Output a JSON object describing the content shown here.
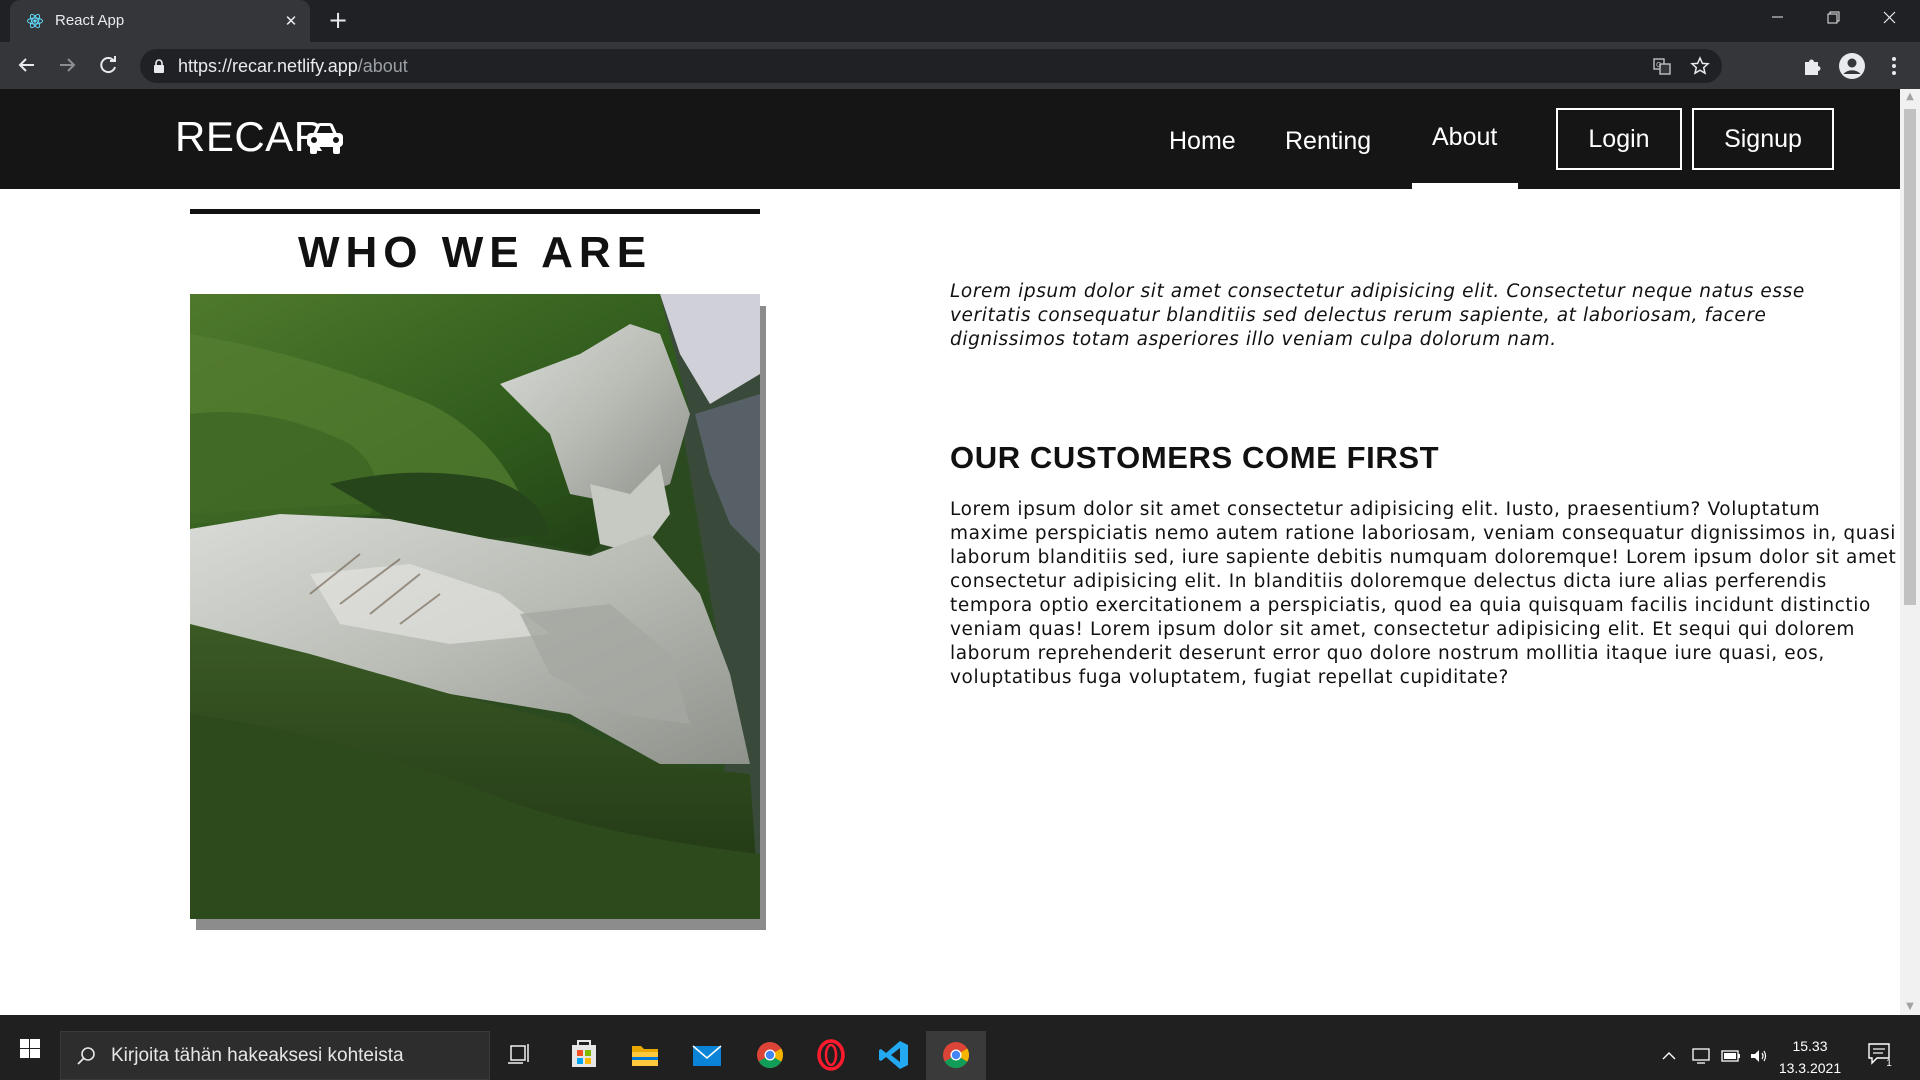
{
  "browser": {
    "tab_title": "React App",
    "tab_close": "✕",
    "new_tab": "+",
    "url_host": "https://recar.netlify.app",
    "url_path": "/about"
  },
  "site": {
    "brand": "RECAR",
    "nav": {
      "home": "Home",
      "renting": "Renting",
      "about": "About",
      "active": "About"
    },
    "login_label": "Login",
    "signup_label": "Signup"
  },
  "page": {
    "who_title": "WHO WE ARE",
    "intro": "Lorem ipsum dolor sit amet consectetur adipisicing elit. Consectetur neque natus esse veritatis consequatur blanditiis sed delectus rerum sapiente, at laboriosam, facere dignissimos totam asperiores illo veniam culpa dolorum nam.",
    "section_title": "OUR CUSTOMERS COME FIRST",
    "section_body": "Lorem ipsum dolor sit amet consectetur adipisicing elit. Iusto, praesentium? Voluptatum maxime perspiciatis nemo autem ratione laboriosam, veniam consequatur dignissimos in, quasi laborum blanditiis sed, iure sapiente debitis numquam doloremque! Lorem ipsum dolor sit amet consectetur adipisicing elit. In blanditiis doloremque delectus dicta iure alias perferendis tempora optio exercitationem a perspiciatis, quod ea quia quisquam facilis incidunt distinctio veniam quas! Lorem ipsum dolor sit amet, consectetur adipisicing elit. Et sequi qui dolorem laborum reprehenderit deserunt error quo dolore nostrum mollitia itaque iure quasi, eos, voluptatibus fuga voluptatem, fugiat repellat cupiditate?"
  },
  "taskbar": {
    "search_placeholder": "Kirjoita tähän hakeaksesi kohteista",
    "time": "15.33",
    "date": "13.3.2021",
    "notification_count": "1",
    "apps": [
      "task-view",
      "microsoft-store",
      "file-explorer",
      "mail",
      "chrome",
      "opera",
      "vscode",
      "chrome-active"
    ]
  },
  "colors": {
    "header_bg": "#151515",
    "chrome_dark": "#202124",
    "chrome_toolbar": "#35363a",
    "taskbar": "#202020",
    "text": "#111111"
  }
}
